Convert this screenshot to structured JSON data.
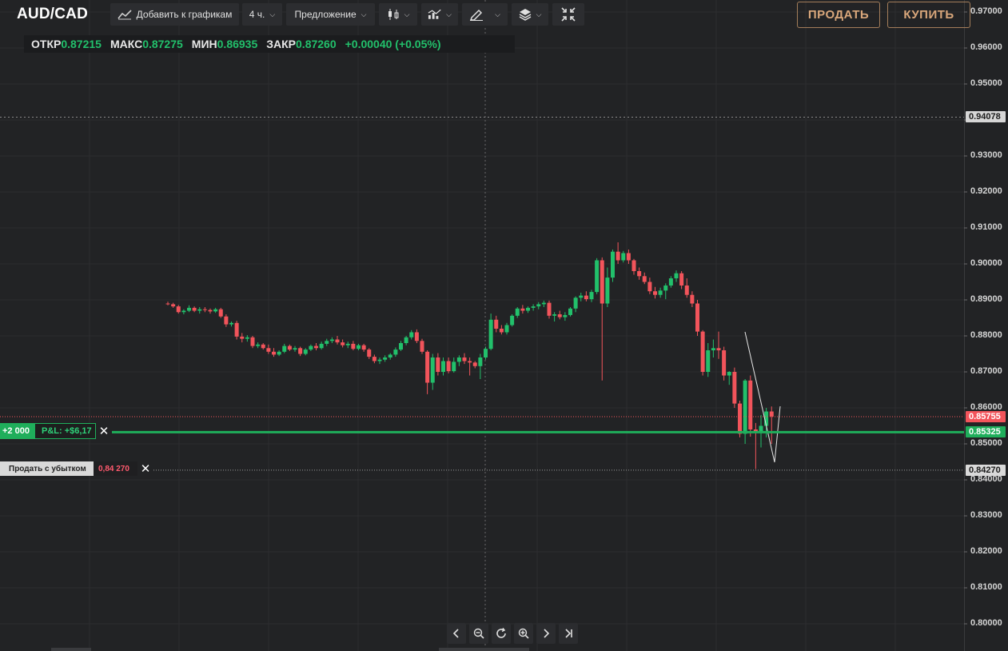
{
  "toolbar": {
    "symbol": "AUD/CAD",
    "add_to_charts": "Добавить к графикам",
    "timeframe": "4 ч.",
    "price_type": "Предложение",
    "chart_type_icon": "candlestick-icon",
    "indicators_icon": "indicators-icon",
    "draw_icon": "pencil-icon",
    "layers_icon": "layers-icon",
    "fullscreen_icon": "collapse-icon",
    "sell_label": "ПРОДАТЬ",
    "buy_label": "КУПИТЬ"
  },
  "ohlc": {
    "open_label": "ОТКР",
    "open": "0.87215",
    "high_label": "МАКС",
    "high": "0.87275",
    "low_label": "МИН",
    "low": "0.86935",
    "close_label": "ЗАКР",
    "close": "0.87260",
    "change": "+0.00040 (+0.05%)"
  },
  "axis": {
    "ticks": [
      "0.97000",
      "0.96000",
      "0.95000",
      "0.94000",
      "0.93000",
      "0.92000",
      "0.91000",
      "0.90000",
      "0.89000",
      "0.88000",
      "0.87000",
      "0.86000",
      "0.85000",
      "0.84000",
      "0.83000",
      "0.82000",
      "0.81000",
      "0.80000"
    ],
    "crosshair_price": "0.94078",
    "ask_price": "0.85755",
    "position_price": "0.85325",
    "stop_price": "0.84270"
  },
  "position": {
    "quantity": "+2 000",
    "pnl": "P&L: +$6,17"
  },
  "stop_loss": {
    "label": "Продать с убытком",
    "price": "0,84 270"
  },
  "colors": {
    "up": "#22c06b",
    "down": "#f2545b",
    "background": "#222325",
    "position_line": "#1fae5b",
    "ask_line": "#f2545b"
  },
  "chart_data": {
    "type": "candlestick",
    "symbol": "AUD/CAD",
    "ylim": [
      0.795,
      0.9755
    ],
    "candles": [
      {
        "o": 0.889,
        "h": 0.8895,
        "l": 0.8885,
        "c": 0.8888
      },
      {
        "o": 0.8888,
        "h": 0.8892,
        "l": 0.8878,
        "c": 0.8882
      },
      {
        "o": 0.8882,
        "h": 0.8886,
        "l": 0.8862,
        "c": 0.8866
      },
      {
        "o": 0.8866,
        "h": 0.8874,
        "l": 0.886,
        "c": 0.887
      },
      {
        "o": 0.887,
        "h": 0.8885,
        "l": 0.8866,
        "c": 0.8878
      },
      {
        "o": 0.8878,
        "h": 0.8882,
        "l": 0.8866,
        "c": 0.887
      },
      {
        "o": 0.887,
        "h": 0.888,
        "l": 0.8862,
        "c": 0.8874
      },
      {
        "o": 0.8874,
        "h": 0.888,
        "l": 0.8866,
        "c": 0.8872
      },
      {
        "o": 0.8872,
        "h": 0.8876,
        "l": 0.8862,
        "c": 0.8868
      },
      {
        "o": 0.8868,
        "h": 0.8878,
        "l": 0.8864,
        "c": 0.8874
      },
      {
        "o": 0.8874,
        "h": 0.8878,
        "l": 0.885,
        "c": 0.8854
      },
      {
        "o": 0.8854,
        "h": 0.886,
        "l": 0.8825,
        "c": 0.8832
      },
      {
        "o": 0.8832,
        "h": 0.884,
        "l": 0.8826,
        "c": 0.8836
      },
      {
        "o": 0.8836,
        "h": 0.8842,
        "l": 0.879,
        "c": 0.8798
      },
      {
        "o": 0.8798,
        "h": 0.8808,
        "l": 0.8782,
        "c": 0.8792
      },
      {
        "o": 0.8792,
        "h": 0.8802,
        "l": 0.8784,
        "c": 0.8796
      },
      {
        "o": 0.8796,
        "h": 0.88,
        "l": 0.8766,
        "c": 0.8772
      },
      {
        "o": 0.8772,
        "h": 0.8782,
        "l": 0.8766,
        "c": 0.8776
      },
      {
        "o": 0.8776,
        "h": 0.878,
        "l": 0.8762,
        "c": 0.8766
      },
      {
        "o": 0.8766,
        "h": 0.8776,
        "l": 0.875,
        "c": 0.8756
      },
      {
        "o": 0.8756,
        "h": 0.8766,
        "l": 0.8742,
        "c": 0.8748
      },
      {
        "o": 0.8748,
        "h": 0.876,
        "l": 0.8744,
        "c": 0.8756
      },
      {
        "o": 0.8756,
        "h": 0.8778,
        "l": 0.8752,
        "c": 0.8772
      },
      {
        "o": 0.8772,
        "h": 0.8776,
        "l": 0.8758,
        "c": 0.8762
      },
      {
        "o": 0.8762,
        "h": 0.8772,
        "l": 0.8756,
        "c": 0.8766
      },
      {
        "o": 0.8766,
        "h": 0.877,
        "l": 0.8744,
        "c": 0.875
      },
      {
        "o": 0.875,
        "h": 0.8766,
        "l": 0.8746,
        "c": 0.8762
      },
      {
        "o": 0.8762,
        "h": 0.8776,
        "l": 0.8758,
        "c": 0.8772
      },
      {
        "o": 0.8772,
        "h": 0.878,
        "l": 0.876,
        "c": 0.8766
      },
      {
        "o": 0.8766,
        "h": 0.8784,
        "l": 0.8762,
        "c": 0.8778
      },
      {
        "o": 0.8778,
        "h": 0.8792,
        "l": 0.8772,
        "c": 0.8786
      },
      {
        "o": 0.8786,
        "h": 0.8796,
        "l": 0.878,
        "c": 0.879
      },
      {
        "o": 0.879,
        "h": 0.88,
        "l": 0.8776,
        "c": 0.8782
      },
      {
        "o": 0.8782,
        "h": 0.879,
        "l": 0.8768,
        "c": 0.8774
      },
      {
        "o": 0.8774,
        "h": 0.8784,
        "l": 0.8766,
        "c": 0.8778
      },
      {
        "o": 0.8778,
        "h": 0.8786,
        "l": 0.876,
        "c": 0.8764
      },
      {
        "o": 0.8764,
        "h": 0.8778,
        "l": 0.876,
        "c": 0.8774
      },
      {
        "o": 0.8774,
        "h": 0.8778,
        "l": 0.8756,
        "c": 0.8762
      },
      {
        "o": 0.8762,
        "h": 0.8766,
        "l": 0.8736,
        "c": 0.8742
      },
      {
        "o": 0.8742,
        "h": 0.8748,
        "l": 0.8724,
        "c": 0.873
      },
      {
        "o": 0.873,
        "h": 0.874,
        "l": 0.8722,
        "c": 0.8734
      },
      {
        "o": 0.8734,
        "h": 0.8746,
        "l": 0.8728,
        "c": 0.874
      },
      {
        "o": 0.874,
        "h": 0.8752,
        "l": 0.8734,
        "c": 0.8748
      },
      {
        "o": 0.8748,
        "h": 0.8768,
        "l": 0.8742,
        "c": 0.8762
      },
      {
        "o": 0.8762,
        "h": 0.8786,
        "l": 0.8758,
        "c": 0.878
      },
      {
        "o": 0.878,
        "h": 0.88,
        "l": 0.8774,
        "c": 0.8796
      },
      {
        "o": 0.8796,
        "h": 0.8816,
        "l": 0.879,
        "c": 0.881
      },
      {
        "o": 0.881,
        "h": 0.8818,
        "l": 0.878,
        "c": 0.8786
      },
      {
        "o": 0.8786,
        "h": 0.8792,
        "l": 0.875,
        "c": 0.8756
      },
      {
        "o": 0.8756,
        "h": 0.876,
        "l": 0.8638,
        "c": 0.867
      },
      {
        "o": 0.867,
        "h": 0.875,
        "l": 0.865,
        "c": 0.874
      },
      {
        "o": 0.874,
        "h": 0.8752,
        "l": 0.869,
        "c": 0.87
      },
      {
        "o": 0.87,
        "h": 0.874,
        "l": 0.869,
        "c": 0.873
      },
      {
        "o": 0.873,
        "h": 0.874,
        "l": 0.8696,
        "c": 0.8702
      },
      {
        "o": 0.8702,
        "h": 0.874,
        "l": 0.8698,
        "c": 0.8728
      },
      {
        "o": 0.8728,
        "h": 0.8746,
        "l": 0.8716,
        "c": 0.874
      },
      {
        "o": 0.874,
        "h": 0.8752,
        "l": 0.8722,
        "c": 0.873
      },
      {
        "o": 0.873,
        "h": 0.874,
        "l": 0.869,
        "c": 0.8726
      },
      {
        "o": 0.8726,
        "h": 0.873,
        "l": 0.871,
        "c": 0.8716
      },
      {
        "o": 0.8716,
        "h": 0.875,
        "l": 0.868,
        "c": 0.874
      },
      {
        "o": 0.874,
        "h": 0.877,
        "l": 0.8734,
        "c": 0.8764
      },
      {
        "o": 0.8764,
        "h": 0.8862,
        "l": 0.876,
        "c": 0.8845
      },
      {
        "o": 0.8845,
        "h": 0.8856,
        "l": 0.881,
        "c": 0.882
      },
      {
        "o": 0.882,
        "h": 0.883,
        "l": 0.8804,
        "c": 0.881
      },
      {
        "o": 0.881,
        "h": 0.8836,
        "l": 0.8804,
        "c": 0.883
      },
      {
        "o": 0.883,
        "h": 0.886,
        "l": 0.8826,
        "c": 0.8856
      },
      {
        "o": 0.8856,
        "h": 0.888,
        "l": 0.885,
        "c": 0.8876
      },
      {
        "o": 0.8876,
        "h": 0.8886,
        "l": 0.8862,
        "c": 0.887
      },
      {
        "o": 0.887,
        "h": 0.8882,
        "l": 0.8864,
        "c": 0.8878
      },
      {
        "o": 0.8878,
        "h": 0.8888,
        "l": 0.887,
        "c": 0.8882
      },
      {
        "o": 0.8882,
        "h": 0.8894,
        "l": 0.8874,
        "c": 0.8888
      },
      {
        "o": 0.8888,
        "h": 0.8898,
        "l": 0.888,
        "c": 0.8892
      },
      {
        "o": 0.8892,
        "h": 0.8898,
        "l": 0.8848,
        "c": 0.8856
      },
      {
        "o": 0.8856,
        "h": 0.8866,
        "l": 0.884,
        "c": 0.886
      },
      {
        "o": 0.886,
        "h": 0.887,
        "l": 0.8846,
        "c": 0.8852
      },
      {
        "o": 0.8852,
        "h": 0.8866,
        "l": 0.8842,
        "c": 0.8858
      },
      {
        "o": 0.8858,
        "h": 0.888,
        "l": 0.8854,
        "c": 0.8876
      },
      {
        "o": 0.8876,
        "h": 0.891,
        "l": 0.8866,
        "c": 0.8906
      },
      {
        "o": 0.8906,
        "h": 0.892,
        "l": 0.8896,
        "c": 0.8912
      },
      {
        "o": 0.8912,
        "h": 0.8924,
        "l": 0.8896,
        "c": 0.8902
      },
      {
        "o": 0.8902,
        "h": 0.8928,
        "l": 0.8894,
        "c": 0.8922
      },
      {
        "o": 0.8922,
        "h": 0.9016,
        "l": 0.8916,
        "c": 0.901
      },
      {
        "o": 0.901,
        "h": 0.9018,
        "l": 0.8676,
        "c": 0.889
      },
      {
        "o": 0.889,
        "h": 0.899,
        "l": 0.888,
        "c": 0.8962
      },
      {
        "o": 0.8962,
        "h": 0.904,
        "l": 0.895,
        "c": 0.9034
      },
      {
        "o": 0.9034,
        "h": 0.906,
        "l": 0.9,
        "c": 0.901
      },
      {
        "o": 0.901,
        "h": 0.9036,
        "l": 0.9004,
        "c": 0.903
      },
      {
        "o": 0.903,
        "h": 0.904,
        "l": 0.9,
        "c": 0.901
      },
      {
        "o": 0.901,
        "h": 0.9014,
        "l": 0.897,
        "c": 0.898
      },
      {
        "o": 0.898,
        "h": 0.899,
        "l": 0.8956,
        "c": 0.8966
      },
      {
        "o": 0.8966,
        "h": 0.8976,
        "l": 0.8944,
        "c": 0.895
      },
      {
        "o": 0.895,
        "h": 0.8962,
        "l": 0.8916,
        "c": 0.8924
      },
      {
        "o": 0.8924,
        "h": 0.8936,
        "l": 0.8904,
        "c": 0.8914
      },
      {
        "o": 0.8914,
        "h": 0.8934,
        "l": 0.8906,
        "c": 0.8926
      },
      {
        "o": 0.8926,
        "h": 0.8946,
        "l": 0.8902,
        "c": 0.894
      },
      {
        "o": 0.894,
        "h": 0.8966,
        "l": 0.8934,
        "c": 0.896
      },
      {
        "o": 0.896,
        "h": 0.8982,
        "l": 0.895,
        "c": 0.8974
      },
      {
        "o": 0.8974,
        "h": 0.898,
        "l": 0.893,
        "c": 0.894
      },
      {
        "o": 0.894,
        "h": 0.896,
        "l": 0.8906,
        "c": 0.8914
      },
      {
        "o": 0.8914,
        "h": 0.8924,
        "l": 0.888,
        "c": 0.889
      },
      {
        "o": 0.889,
        "h": 0.89,
        "l": 0.88,
        "c": 0.8812
      },
      {
        "o": 0.8812,
        "h": 0.8816,
        "l": 0.869,
        "c": 0.87
      },
      {
        "o": 0.87,
        "h": 0.878,
        "l": 0.8686,
        "c": 0.876
      },
      {
        "o": 0.876,
        "h": 0.879,
        "l": 0.874,
        "c": 0.8766
      },
      {
        "o": 0.8766,
        "h": 0.8812,
        "l": 0.8736,
        "c": 0.876
      },
      {
        "o": 0.876,
        "h": 0.877,
        "l": 0.8676,
        "c": 0.869
      },
      {
        "o": 0.869,
        "h": 0.8702,
        "l": 0.8664,
        "c": 0.87
      },
      {
        "o": 0.87,
        "h": 0.8712,
        "l": 0.86,
        "c": 0.8612
      },
      {
        "o": 0.8612,
        "h": 0.862,
        "l": 0.8518,
        "c": 0.8528
      },
      {
        "o": 0.8528,
        "h": 0.868,
        "l": 0.85,
        "c": 0.8676
      },
      {
        "o": 0.8676,
        "h": 0.869,
        "l": 0.852,
        "c": 0.854
      },
      {
        "o": 0.854,
        "h": 0.8558,
        "l": 0.843,
        "c": 0.853
      },
      {
        "o": 0.853,
        "h": 0.858,
        "l": 0.849,
        "c": 0.855
      },
      {
        "o": 0.855,
        "h": 0.86,
        "l": 0.8518,
        "c": 0.859
      },
      {
        "o": 0.859,
        "h": 0.8604,
        "l": 0.85,
        "c": 0.8576
      }
    ]
  }
}
